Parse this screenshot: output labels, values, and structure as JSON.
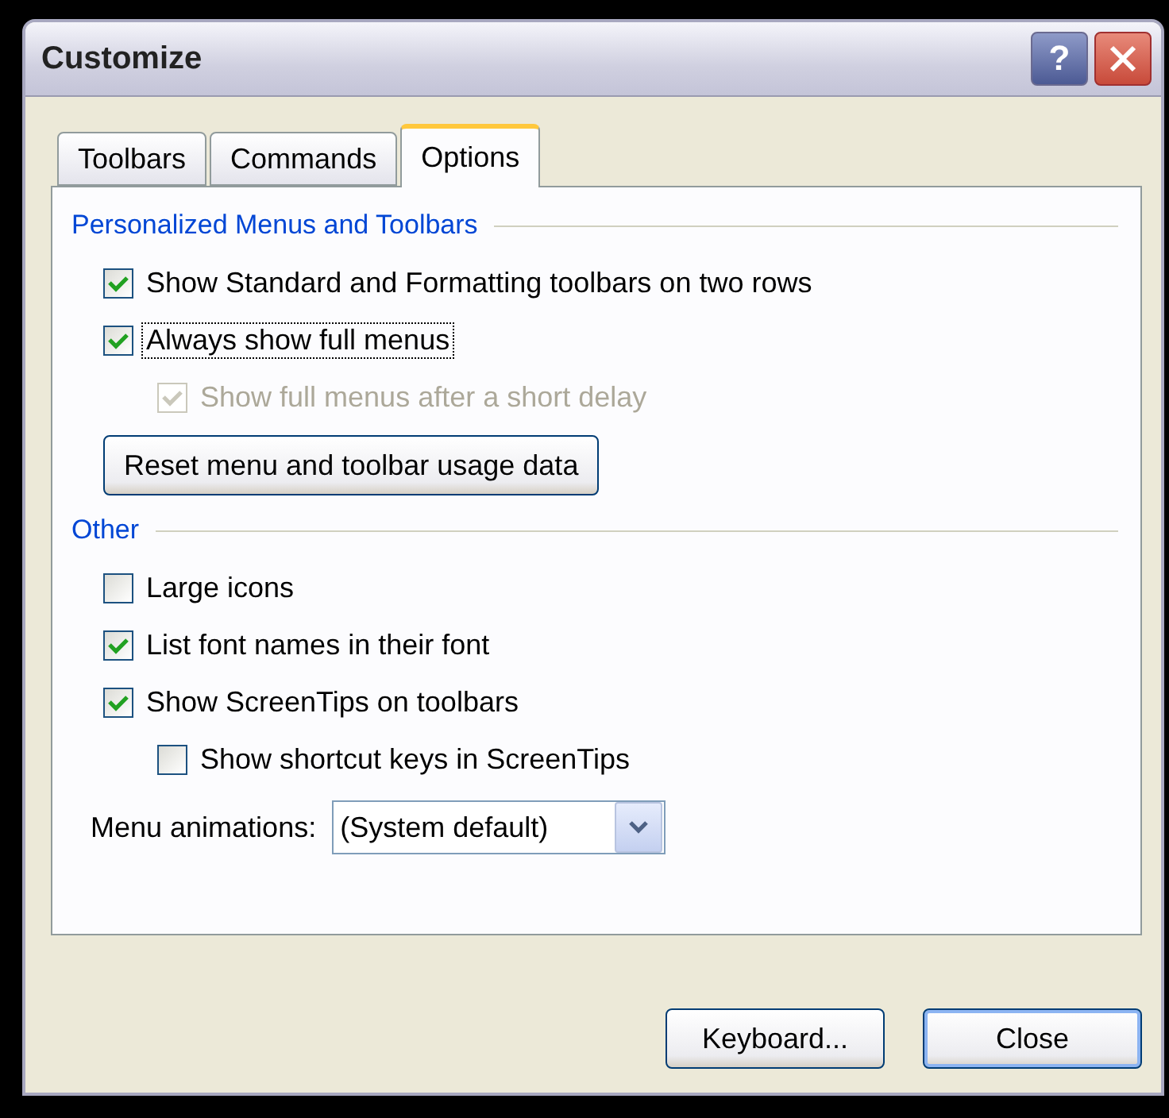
{
  "window": {
    "title": "Customize"
  },
  "title_buttons": [
    {
      "kind": "help",
      "label": "?"
    },
    {
      "kind": "close"
    }
  ],
  "tabs": [
    {
      "label": "Toolbars",
      "selected": false
    },
    {
      "label": "Commands",
      "selected": false
    },
    {
      "label": "Options",
      "selected": true
    }
  ],
  "sections": [
    {
      "title": "Personalized Menus and Toolbars",
      "items": [
        {
          "kind": "checkbox",
          "label": "Show Standard and Formatting toolbars on two rows",
          "checked": true,
          "disabled": false,
          "focused": false
        },
        {
          "kind": "checkbox",
          "label": "Always show full menus",
          "checked": true,
          "disabled": false,
          "focused": true,
          "children": [
            {
              "kind": "checkbox",
              "label": "Show full menus after a short delay",
              "checked": true,
              "disabled": true,
              "focused": false
            }
          ]
        },
        {
          "kind": "button",
          "label": "Reset menu and toolbar usage data"
        }
      ]
    },
    {
      "title": "Other",
      "items": [
        {
          "kind": "checkbox",
          "label": "Large icons",
          "checked": false,
          "disabled": false,
          "focused": false
        },
        {
          "kind": "checkbox",
          "label": "List font names in their font",
          "checked": true,
          "disabled": false,
          "focused": false
        },
        {
          "kind": "checkbox",
          "label": "Show ScreenTips on toolbars",
          "checked": true,
          "disabled": false,
          "focused": false,
          "children": [
            {
              "kind": "checkbox",
              "label": "Show shortcut keys in ScreenTips",
              "checked": false,
              "disabled": false,
              "focused": false
            }
          ]
        },
        {
          "kind": "dropdown",
          "label": "Menu animations:",
          "value": "(System default)"
        }
      ]
    }
  ],
  "buttons": [
    {
      "label": "Keyboard...",
      "default": false
    },
    {
      "label": "Close",
      "default": true
    }
  ]
}
